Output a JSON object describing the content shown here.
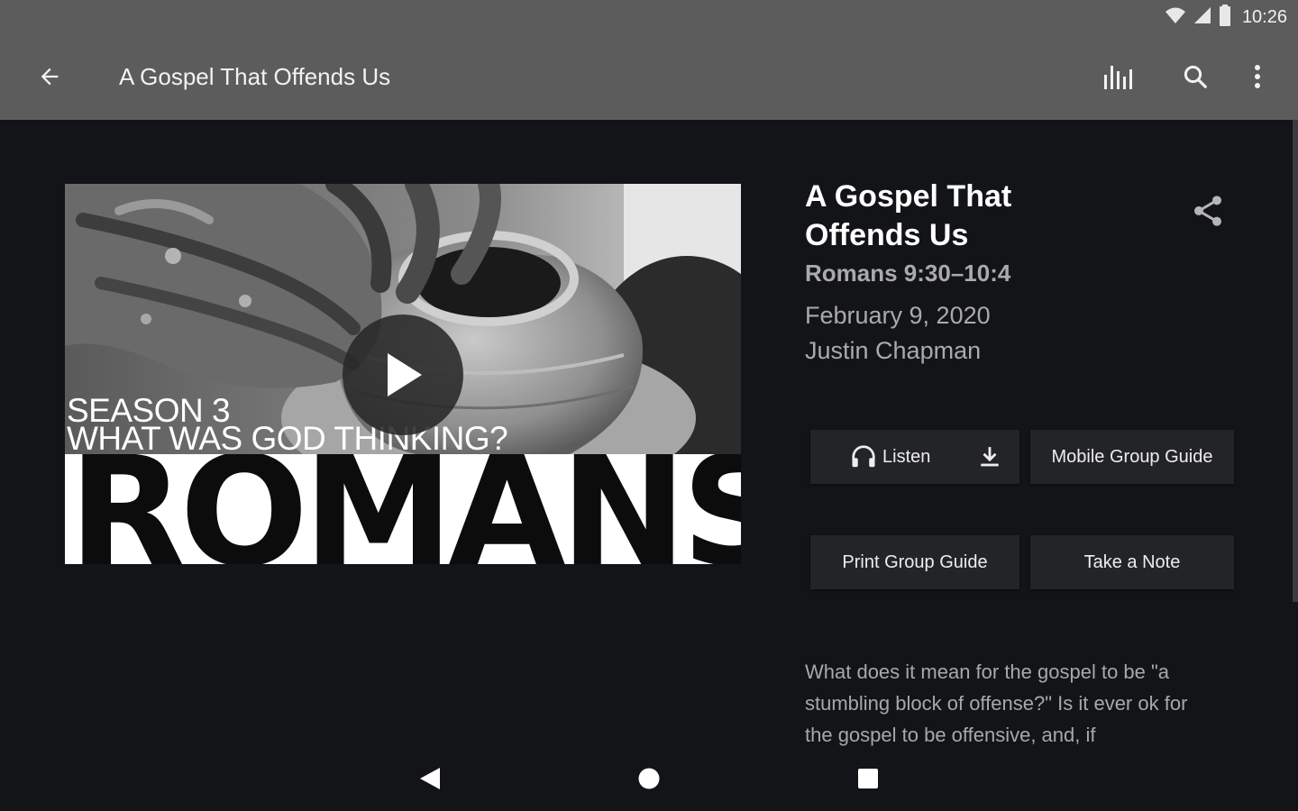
{
  "status_bar": {
    "time": "10:26",
    "icons": [
      "wifi-icon",
      "cell-signal-icon",
      "battery-icon"
    ]
  },
  "app_bar": {
    "title": "A Gospel That Offends Us",
    "back_icon": "arrow-back-icon",
    "actions": [
      "equalizer-icon",
      "search-icon",
      "more-vert-icon"
    ]
  },
  "hero": {
    "season_line": "SEASON 3",
    "subtitle_line": "WHAT WAS GOD THINKING?",
    "series_title": "ROMANS",
    "play_icon": "play-icon"
  },
  "sermon": {
    "title": "A Gospel That Offends Us",
    "scripture": "Romans 9:30–10:4",
    "date": "February 9, 2020",
    "speaker": "Justin Chapman",
    "share_icon": "share-icon"
  },
  "buttons": {
    "listen": "Listen",
    "mobile_group_guide": "Mobile Group Guide",
    "print_group_guide": "Print Group Guide",
    "take_note": "Take a Note"
  },
  "description": "What does it mean for the gospel to be \"a stumbling block of offense?\" Is it ever ok for the gospel to be offensive, and, if",
  "nav_bar": {
    "icons": [
      "nav-back-icon",
      "nav-home-icon",
      "nav-recents-icon"
    ]
  },
  "colors": {
    "background": "#131417",
    "app_bar": "#5c5c5c",
    "button": "#232427",
    "secondary_text": "#aaaaaa"
  }
}
